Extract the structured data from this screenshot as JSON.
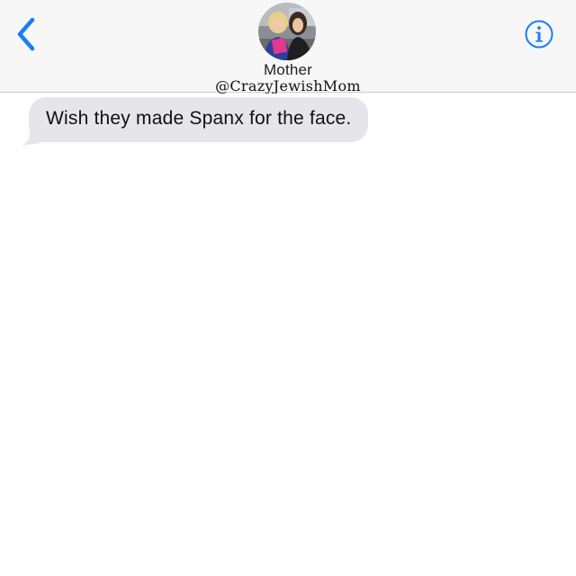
{
  "header": {
    "contact_name": "Mother",
    "watermark": "@CrazyJewishMom",
    "back_icon": "chevron-left-icon",
    "info_icon": "info-circle-icon",
    "accent_color": "#1a7df5"
  },
  "messages": [
    {
      "direction": "incoming",
      "text": "Wish they made Spanx for the face."
    }
  ],
  "colors": {
    "header_bg": "#f7f7f7",
    "incoming_bubble": "#e5e5ea"
  }
}
